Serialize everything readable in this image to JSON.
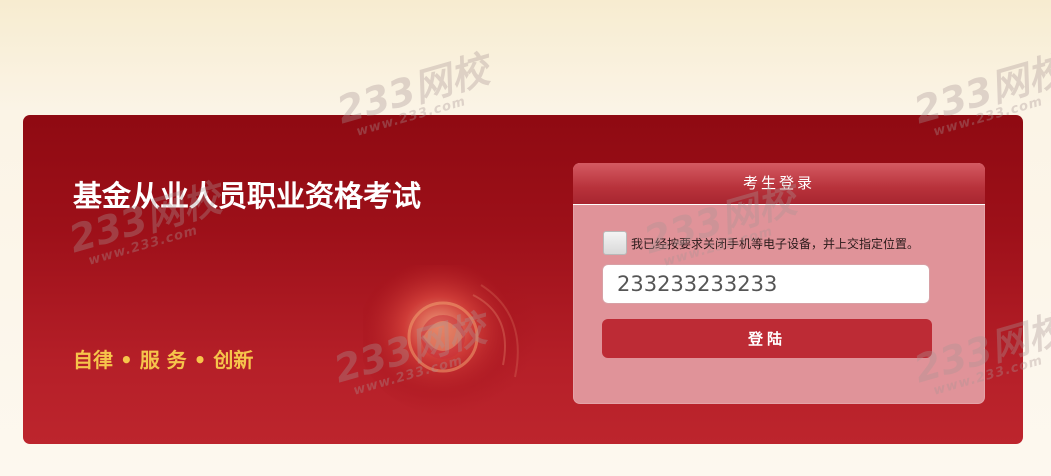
{
  "exam": {
    "title": "基金从业人员职业资格考试",
    "slogan": "自律 • 服 务 • 创新"
  },
  "login": {
    "header": "考生登录",
    "agreement_text": "我已经按要求关闭手机等电子设备，并上交指定位置。",
    "agreement_checked": false,
    "ticket_input_value": "233233233233",
    "submit_label": "登陆"
  },
  "watermark": {
    "brand": "233网校",
    "domain": "www.233.com"
  },
  "colors": {
    "panel_top": "#8f0a12",
    "panel_bottom": "#bd252d",
    "slogan": "#f6c44b",
    "login_body": "#e09399",
    "button": "#bd2b35"
  }
}
